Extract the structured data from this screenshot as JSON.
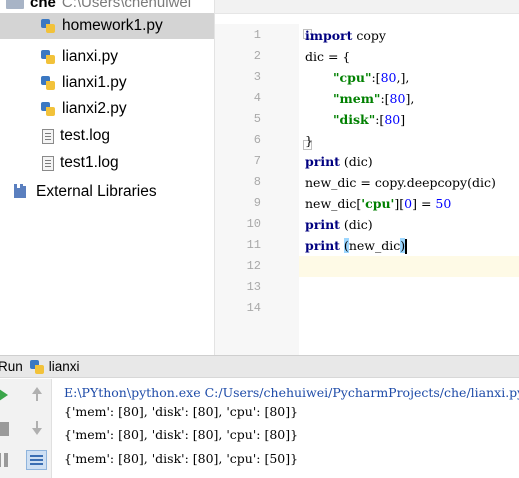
{
  "project_tree": {
    "root": {
      "name": "che",
      "path": "C:\\Users\\chehuiwei"
    },
    "items": [
      {
        "label": "homework1.py",
        "icon": "python-file-icon",
        "selected": true
      },
      {
        "label": "lianxi.py",
        "icon": "python-file-icon",
        "selected": false
      },
      {
        "label": "lianxi1.py",
        "icon": "python-file-icon",
        "selected": false
      },
      {
        "label": "lianxi2.py",
        "icon": "python-file-icon",
        "selected": false
      },
      {
        "label": "test.log",
        "icon": "text-file-icon",
        "selected": false
      },
      {
        "label": "test1.log",
        "icon": "text-file-icon",
        "selected": false
      },
      {
        "label": "External Libraries",
        "icon": "library-icon",
        "selected": false
      }
    ]
  },
  "editor": {
    "line_numbers": [
      "1",
      "2",
      "3",
      "4",
      "5",
      "6",
      "7",
      "8",
      "9",
      "10",
      "11",
      "12",
      "13",
      "14"
    ],
    "lines": {
      "l1": {
        "kw": "import",
        "rest": " copy"
      },
      "l2": {
        "text": "dic = {"
      },
      "l3": {
        "key": "\"cpu\"",
        "rest": ":[80,],",
        "num": "80"
      },
      "l4": {
        "key": "\"mem\"",
        "rest": ":[80],",
        "num": "80"
      },
      "l5": {
        "key": "\"disk\"",
        "rest": ":[80]",
        "num": "80"
      },
      "l6": {
        "text": "}"
      },
      "l7": {
        "kw": "print",
        "rest": " (dic)"
      },
      "l8": {
        "text": "new_dic = copy.deepcopy(dic)"
      },
      "l9": {
        "pre": "new_dic[",
        "key": "'cpu'",
        "mid": "][",
        "idx": "0",
        "post": "] = ",
        "num": "50"
      },
      "l10": {
        "kw": "print",
        "rest": " (dic)"
      },
      "l11": {
        "kw": "print",
        "open": "(",
        "arg": "new_dic",
        "close": ")"
      }
    },
    "current_line": 11,
    "colors": {
      "keyword": "#000080",
      "string": "#008000",
      "number": "#0000ff",
      "caret_line": "#fefae6",
      "bracket_highlight": "#9dd7ff"
    }
  },
  "run_window": {
    "tab_label": "Run",
    "config_name": "lianxi",
    "output": [
      {
        "kind": "cmd",
        "text": "E:\\PYthon\\python.exe C:/Users/chehuiwei/PycharmProjects/che/lianxi.py"
      },
      {
        "kind": "out",
        "text": "{'mem': [80], 'disk': [80], 'cpu': [80]}"
      },
      {
        "kind": "out",
        "text": "{'mem': [80], 'disk': [80], 'cpu': [80]}"
      },
      {
        "kind": "out",
        "text": "{'mem': [80], 'disk': [80], 'cpu': [50]}"
      }
    ],
    "buttons": [
      "rerun-icon",
      "stop-icon",
      "pause-icon",
      "scroll-up-icon",
      "scroll-down-icon",
      "soft-wrap-icon"
    ]
  }
}
